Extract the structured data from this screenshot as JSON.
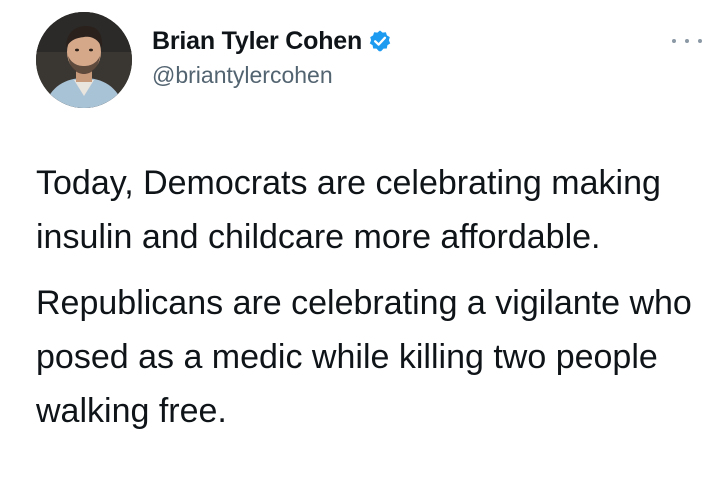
{
  "author": {
    "display_name": "Brian Tyler Cohen",
    "handle": "@briantylercohen",
    "verified": true,
    "verified_color": "#1d9bf0"
  },
  "icons": {
    "verified": "verified-badge-icon",
    "more": "more-options-icon"
  },
  "tweet": {
    "paragraphs": [
      "Today, Democrats are celebrating making insulin and childcare more affordable.",
      "Republicans are celebrating a vigilante who posed as a medic while killing two people walking free."
    ]
  }
}
